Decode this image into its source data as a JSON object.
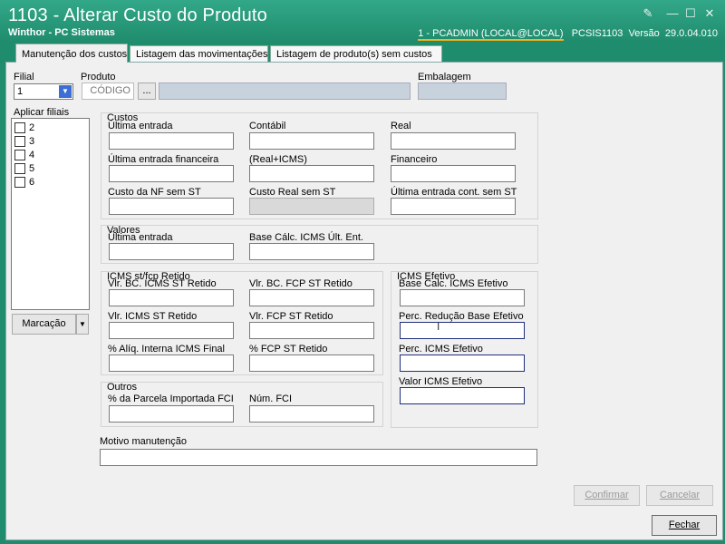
{
  "window": {
    "title": "1103 - Alterar Custo do Produto",
    "subtitle": "Winthor - PC Sistemas",
    "user": "1 - PCADMIN (LOCAL@LOCAL)",
    "program": "PCSIS1103",
    "version_label": "Versão",
    "version": "29.0.04.010"
  },
  "tabs": [
    {
      "label": "Manutenção dos custos"
    },
    {
      "label": "Listagem das movimentações"
    },
    {
      "label": "Listagem de produto(s)  sem custos"
    }
  ],
  "header": {
    "filial_label": "Filial",
    "filial_value": "1",
    "produto_label": "Produto",
    "produto_code": "CÓDIGO",
    "produto_search": "...",
    "embalagem_label": "Embalagem"
  },
  "filiais": {
    "label": "Aplicar filiais",
    "items": [
      "2",
      "3",
      "4",
      "5",
      "6"
    ],
    "marcacao": "Marcação"
  },
  "custos": {
    "title": "Custos",
    "ultima_entrada": "Última entrada",
    "contabil": "Contábil",
    "real": "Real",
    "ultima_entrada_financeira": "Última entrada financeira",
    "real_icms": "(Real+ICMS)",
    "financeiro": "Financeiro",
    "custo_nf_sem_st": "Custo da NF sem ST",
    "custo_real_sem_st": "Custo Real sem ST",
    "ultima_entrada_cont_sem_st": "Última entrada cont. sem ST"
  },
  "valores": {
    "title": "Valores",
    "ultima_entrada": "Última entrada",
    "base_calc": "Base Cálc. ICMS Últ. Ent."
  },
  "icms_st": {
    "title": "ICMS st/fcp Retido",
    "vlr_bc_icms": "Vlr. BC. ICMS ST Retido",
    "vlr_bc_fcp": "Vlr. BC. FCP ST Retido",
    "vlr_icms": "Vlr. ICMS ST Retido",
    "vlr_fcp": "Vlr. FCP ST Retido",
    "aliq_interna": "% Alíq. Interna ICMS Final",
    "fcp_retido": "% FCP ST Retido"
  },
  "outros": {
    "title": "Outros",
    "parcela_fci": "% da Parcela Importada FCI",
    "num_fci": "Núm. FCI"
  },
  "icms_efetivo": {
    "title": "ICMS Efetivo",
    "base_calc": "Base Calc. ICMS Efetivo",
    "perc_reducao": "Perc. Redução Base Efetivo",
    "perc_icms": "Perc. ICMS Efetivo",
    "valor_icms": "Valor ICMS Efetivo"
  },
  "motivo": {
    "label": "Motivo manutenção"
  },
  "buttons": {
    "confirmar": "Confirmar",
    "cancelar": "Cancelar",
    "fechar": "Fechar"
  }
}
